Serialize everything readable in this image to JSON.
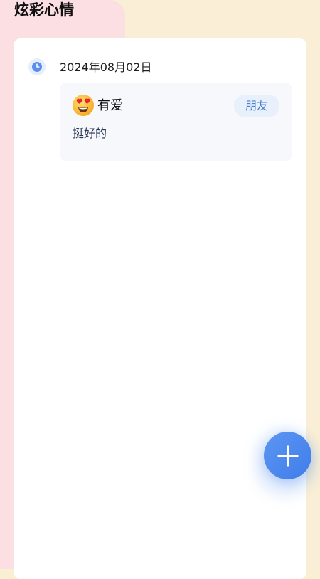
{
  "header": {
    "title": "炫彩心情"
  },
  "timeline": {
    "entries": [
      {
        "date": "2024年08月02日",
        "mood_label": "有爱",
        "mood_icon": "heart-eyes-emoji-icon",
        "tag": "朋友",
        "note": "挺好的"
      }
    ]
  },
  "fab": {
    "icon": "plus-icon"
  },
  "colors": {
    "bg_pink": "#fbdfe3",
    "bg_cream": "#faefd6",
    "accent_blue": "#4a85ef",
    "tag_text": "#4a7fd0"
  }
}
